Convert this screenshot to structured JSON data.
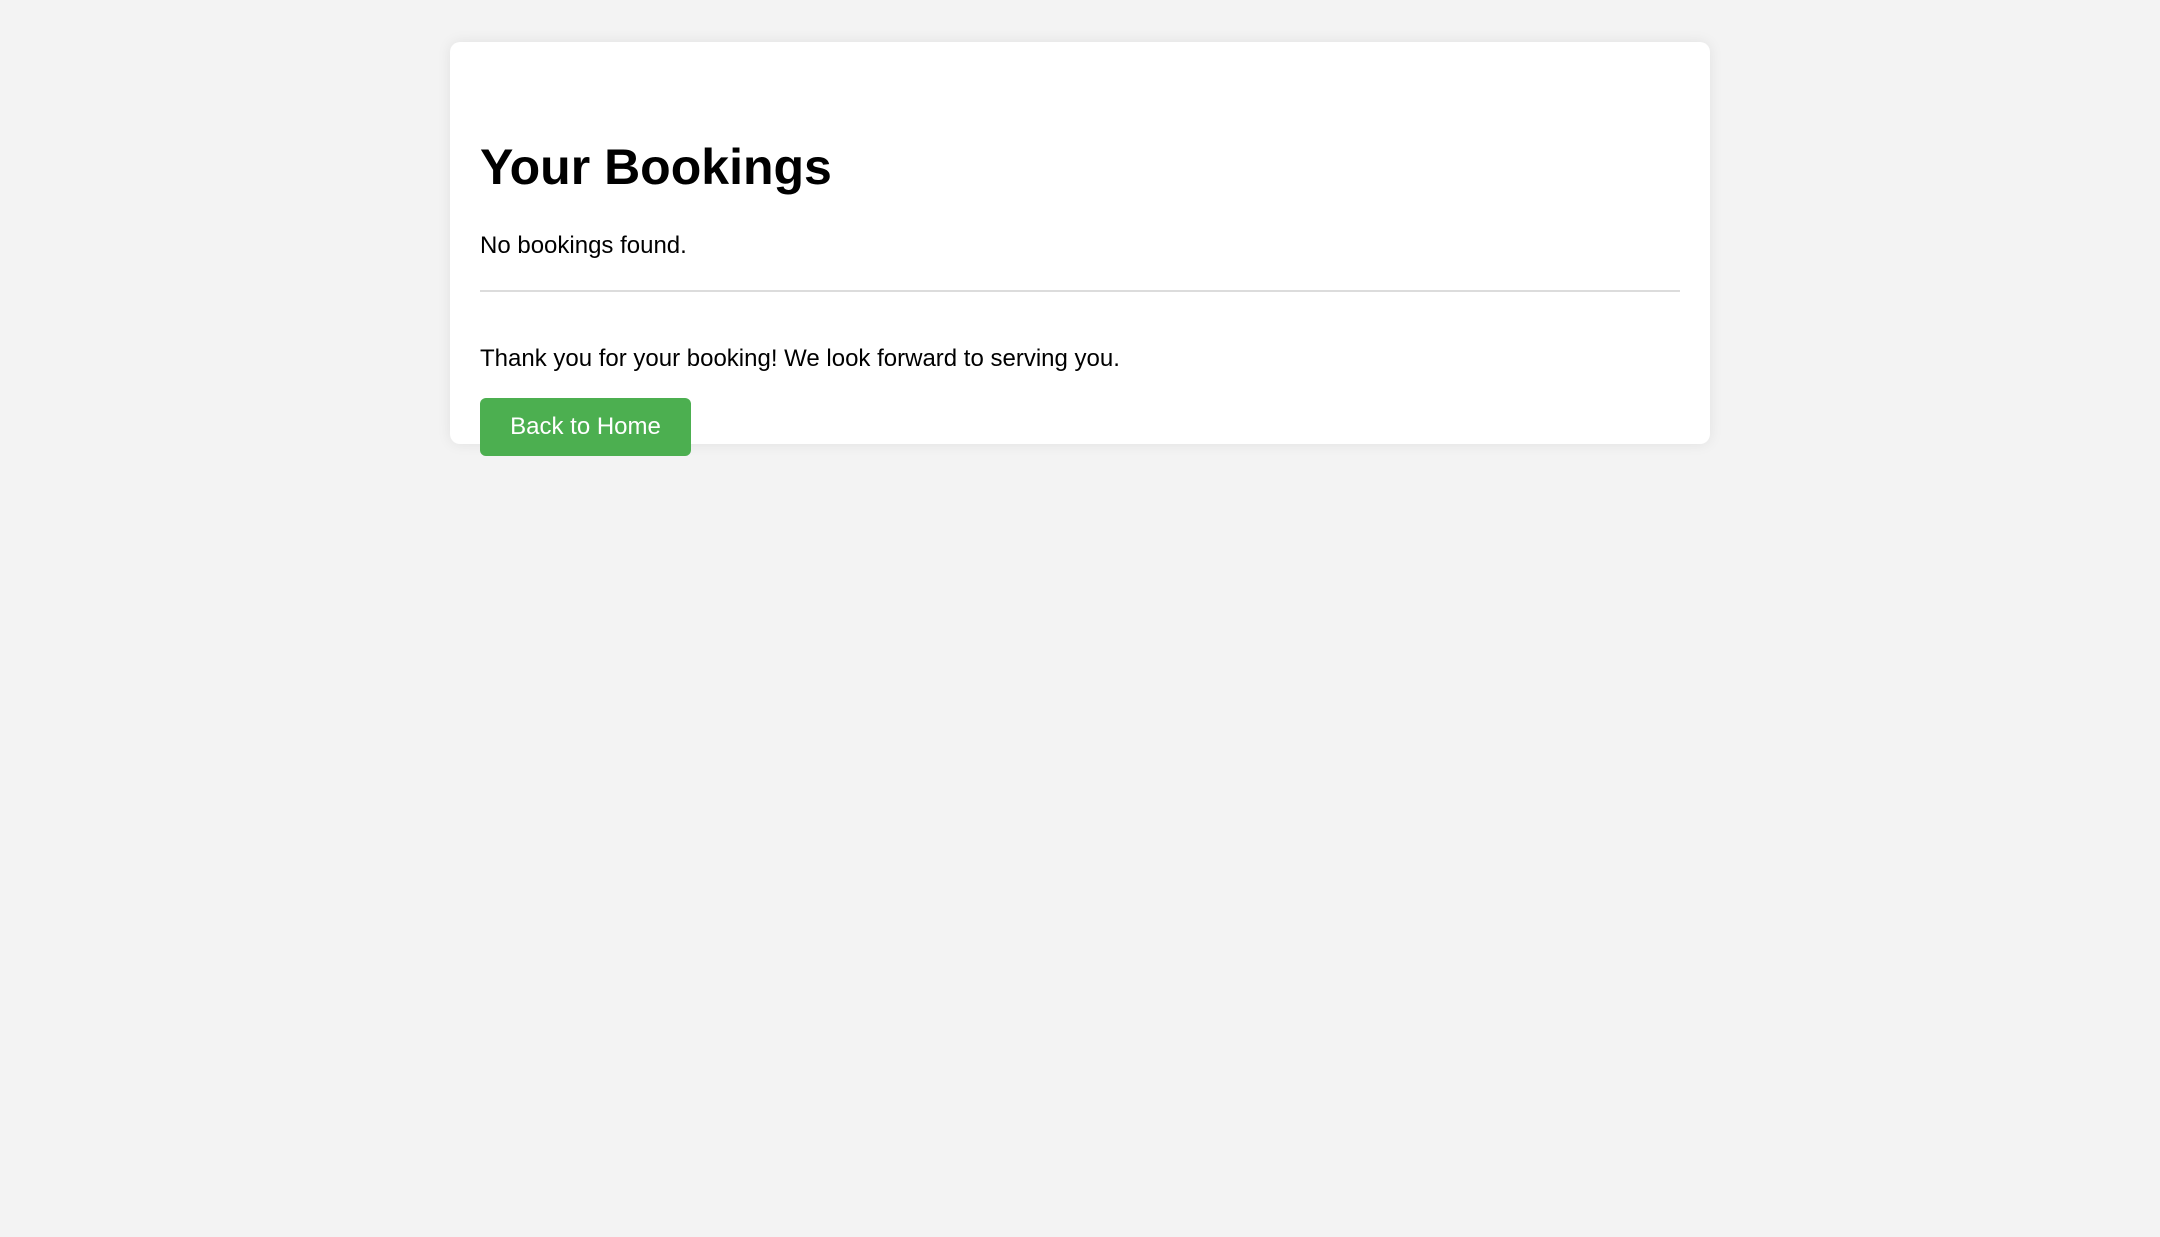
{
  "page": {
    "heading": "Your Bookings",
    "empty_message": "No bookings found.",
    "thanks_message": "Thank you for your booking! We look forward to serving you.",
    "home_button_label": "Back to Home"
  },
  "colors": {
    "background": "#f3f3f3",
    "card": "#ffffff",
    "button": "#4caf50",
    "button_text": "#ffffff",
    "divider": "#dcdcdc"
  }
}
